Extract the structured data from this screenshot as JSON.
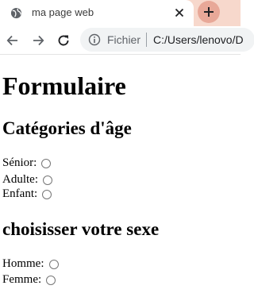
{
  "browser": {
    "tab_title": "ma page web",
    "site_info_label": "Fichier",
    "url": "C:/Users/lenovo/D"
  },
  "page": {
    "title": "Formulaire",
    "age_section": {
      "heading": "Catégories d'âge",
      "options": [
        {
          "label": "Sénior:",
          "checked": false
        },
        {
          "label": "Adulte:",
          "checked": false
        },
        {
          "label": "Enfant:",
          "checked": false
        }
      ]
    },
    "sex_section": {
      "heading": "choisisser votre sexe",
      "options": [
        {
          "label": "Homme:",
          "checked": false
        },
        {
          "label": "Femme:",
          "checked": false
        }
      ]
    }
  },
  "icons": {
    "favicon": "globe-icon",
    "close": "close-icon",
    "new_tab": "plus-icon",
    "back": "arrow-left-icon",
    "forward": "arrow-right-icon",
    "reload": "reload-icon",
    "site_info": "info-icon"
  },
  "colors": {
    "tabstrip": "#f7d8cc",
    "newtab_button": "#e8a898",
    "omnibox": "#f1f3f4"
  }
}
